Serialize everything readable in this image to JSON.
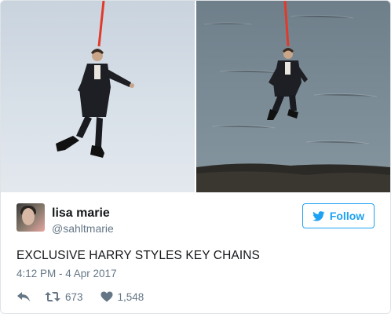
{
  "media": {
    "left_photo": "photo-1",
    "right_photo": "photo-2"
  },
  "user": {
    "name": "lisa marie",
    "handle": "@sahltmarie"
  },
  "follow_label": "Follow",
  "tweet_text": "EXCLUSIVE HARRY STYLES KEY CHAINS",
  "timestamp": "4:12 PM - 4 Apr 2017",
  "actions": {
    "retweets": "673",
    "likes": "1,548"
  },
  "colors": {
    "accent": "#1da1f2",
    "muted": "#657786",
    "text": "#14171a"
  },
  "icons": [
    "reply-icon",
    "retweet-icon",
    "heart-icon",
    "twitter-bird-icon"
  ]
}
